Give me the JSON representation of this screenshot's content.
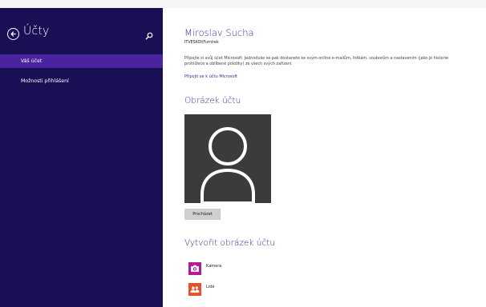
{
  "sidebar": {
    "title": "Účty",
    "items": [
      {
        "label": "Váš účet"
      },
      {
        "label": "Možnosti přihlášení"
      }
    ]
  },
  "account": {
    "name": "Miroslav Sucha",
    "subtitle": "ITVESKOI\\Furnirek",
    "description": "Připojte si svůj účet Microsoft. Jednoduše se pak dostanete ke svým online e-mailům, fotkám, souborům a nastavením (jako je historie prohlížeče a oblíbené položky) ze všech svých zařízení.",
    "link": "Připojit se k účtu Microsoft"
  },
  "picture": {
    "heading": "Obrázek účtu",
    "browse_label": "Procházet"
  },
  "create": {
    "heading": "Vytvořit obrázek účtu",
    "items": [
      {
        "label": "Kamera",
        "icon": "camera-icon",
        "color": "#b4199e"
      },
      {
        "label": "Lidé",
        "icon": "people-icon",
        "color": "#e4512a"
      }
    ]
  },
  "colors": {
    "sidebar_bg": "#180f55",
    "sidebar_active": "#4b239e",
    "accent": "#4b239e"
  }
}
